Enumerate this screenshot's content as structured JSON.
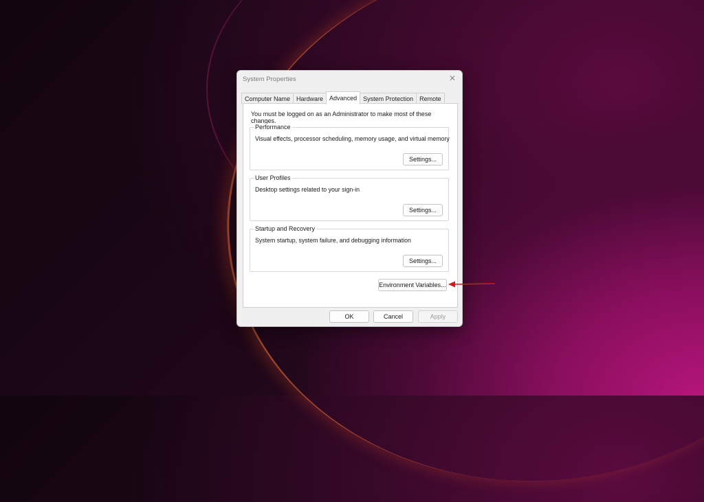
{
  "dialog": {
    "title": "System Properties",
    "close_glyph": "✕"
  },
  "tabs": [
    {
      "label": "Computer Name",
      "active": false
    },
    {
      "label": "Hardware",
      "active": false
    },
    {
      "label": "Advanced",
      "active": true
    },
    {
      "label": "System Protection",
      "active": false
    },
    {
      "label": "Remote",
      "active": false
    }
  ],
  "advanced": {
    "notice": "You must be logged on as an Administrator to make most of these changes.",
    "performance": {
      "label": "Performance",
      "description": "Visual effects, processor scheduling, memory usage, and virtual memory",
      "button": "Settings..."
    },
    "user_profiles": {
      "label": "User Profiles",
      "description": "Desktop settings related to your sign-in",
      "button": "Settings..."
    },
    "startup_recovery": {
      "label": "Startup and Recovery",
      "description": "System startup, system failure, and debugging information",
      "button": "Settings..."
    },
    "env_button": "Environment Variables..."
  },
  "footer": {
    "ok": "OK",
    "cancel": "Cancel",
    "apply": "Apply"
  },
  "annotation": {
    "arrow_color": "#d11a1a",
    "icon": "red-arrow-icon"
  }
}
